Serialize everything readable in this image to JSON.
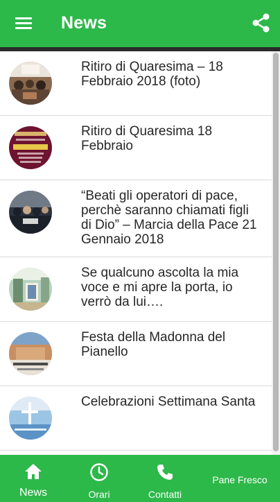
{
  "header": {
    "title": "News",
    "menu_icon": "hamburger-menu-icon",
    "share_icon": "share-icon"
  },
  "news": [
    {
      "title": "Ritiro di Quaresima – 18 Febbraio 2018 (foto)",
      "thumb": "photo-thumbnail"
    },
    {
      "title": "Ritiro di Quaresima 18 Febbraio",
      "thumb": "poster-thumbnail"
    },
    {
      "title": "“Beati gli operatori di pace, perchè saranno chiamati figli di Dio” – Marcia della Pace 21 Gennaio 2018",
      "thumb": "photo-thumbnail"
    },
    {
      "title": "Se qualcuno ascolta la mia voce e mi apre la porta, io verrò da lui….",
      "thumb": "photo-thumbnail"
    },
    {
      "title": "Festa della Madonna del Pianello",
      "thumb": "photo-thumbnail"
    },
    {
      "title": "Celebrazioni Settimana Santa",
      "thumb": "poster-thumbnail"
    }
  ],
  "bottom_nav": {
    "items": [
      {
        "label": "News",
        "icon": "home-icon",
        "active": true
      },
      {
        "label": "Orari",
        "icon": "clock-icon",
        "active": false
      },
      {
        "label": "Contatti",
        "icon": "phone-icon",
        "active": false
      },
      {
        "label": "Pane Fresco",
        "icon": "",
        "active": false
      }
    ]
  },
  "colors": {
    "primary": "#2db84a",
    "text": "#262626",
    "divider": "#d9d9d9"
  }
}
